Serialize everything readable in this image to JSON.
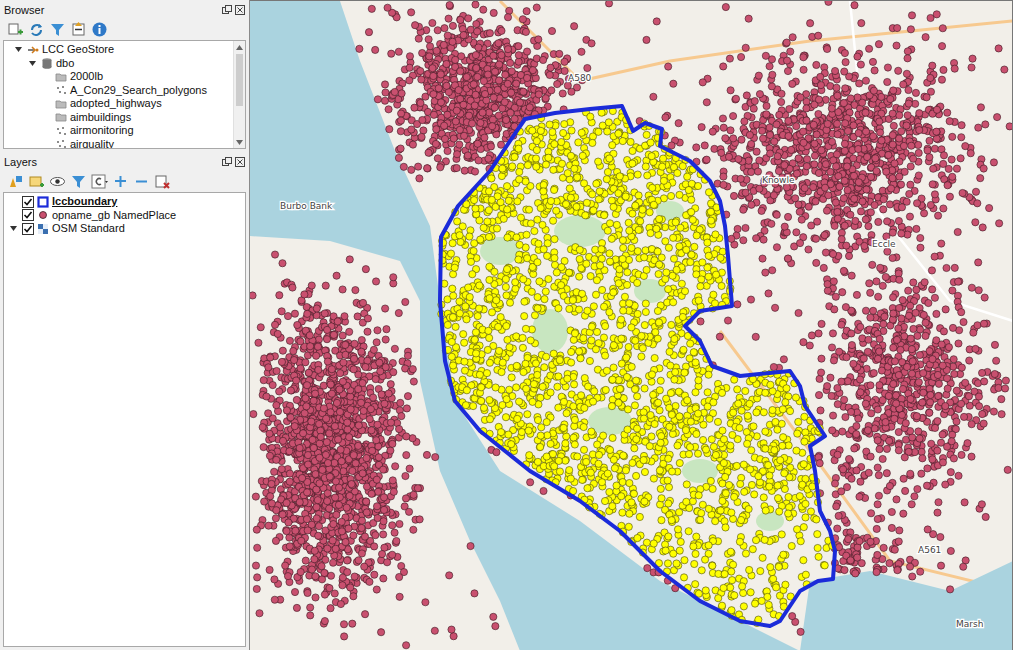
{
  "browser": {
    "title": "Browser",
    "tree": [
      {
        "label": "LCC GeoStore",
        "kind": "connection",
        "expanded": true,
        "children": [
          {
            "label": "dbo",
            "kind": "schema",
            "expanded": true,
            "children": [
              {
                "label": "2000lb",
                "kind": "table"
              },
              {
                "label": "A_Con29_Search_polygons",
                "kind": "points"
              },
              {
                "label": "adopted_highways",
                "kind": "table"
              },
              {
                "label": "aimbuildings",
                "kind": "table"
              },
              {
                "label": "airmonitoring",
                "kind": "points"
              },
              {
                "label": "airquality",
                "kind": "points"
              }
            ]
          }
        ]
      }
    ]
  },
  "layers": {
    "title": "Layers",
    "items": [
      {
        "label": "lccboundary",
        "kind": "polygon",
        "checked": true,
        "selected": true,
        "expanded": false,
        "color": "#1b2bd9"
      },
      {
        "label": "opname_gb NamedPlace",
        "kind": "point",
        "checked": true,
        "selected": false,
        "expanded": false,
        "color": "#c9506f"
      },
      {
        "label": "OSM Standard",
        "kind": "raster",
        "checked": true,
        "selected": false,
        "expanded": true,
        "color": "#3a6fb0"
      }
    ]
  },
  "map": {
    "labels": [
      "Burbo Bank",
      "A580",
      "Knowle",
      "Eccle",
      "A561",
      "Marsh"
    ]
  }
}
